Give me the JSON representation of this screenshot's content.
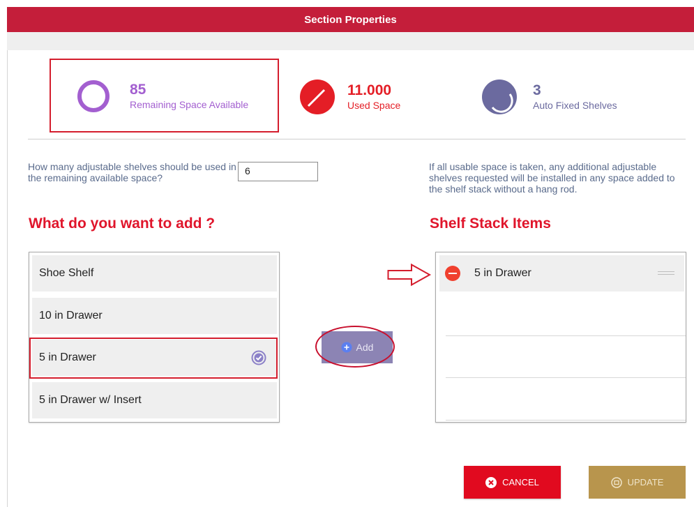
{
  "header": {
    "title": "Section Properties"
  },
  "stats": {
    "remaining": {
      "value": "85",
      "label": "Remaining Space Available",
      "icon": "ring-icon",
      "color": "#a35fd0"
    },
    "used": {
      "value": "11.000",
      "label": "Used Space",
      "icon": "pie-full-icon",
      "color": "#e41e26"
    },
    "auto": {
      "value": "3",
      "label": "Auto Fixed Shelves",
      "icon": "pie-partial-icon",
      "color": "#6b6a9f"
    }
  },
  "shelves": {
    "question": "How many adjustable shelves should be used in the remaining available space?",
    "input_value": "6",
    "note": "If all usable space is taken, any additional adjustable shelves requested will be installed in any space added to the shelf stack without a hang rod."
  },
  "add_section": {
    "title": "What do you want to add ?",
    "items": [
      {
        "label": "Shoe Shelf"
      },
      {
        "label": "10 in Drawer"
      },
      {
        "label": "5 in Drawer",
        "selected": true
      },
      {
        "label": "5 in Drawer w/ Insert"
      }
    ],
    "add_label": "Add"
  },
  "stack_section": {
    "title": "Shelf Stack Items",
    "items": [
      {
        "label": "5 in Drawer"
      }
    ]
  },
  "buttons": {
    "cancel": "CANCEL",
    "update": "UPDATE"
  },
  "colors": {
    "header": "#c41e3a",
    "accent_red": "#e0152b",
    "cancel": "#e10a1f",
    "update": "#b8954d",
    "add": "#8c84b4"
  }
}
